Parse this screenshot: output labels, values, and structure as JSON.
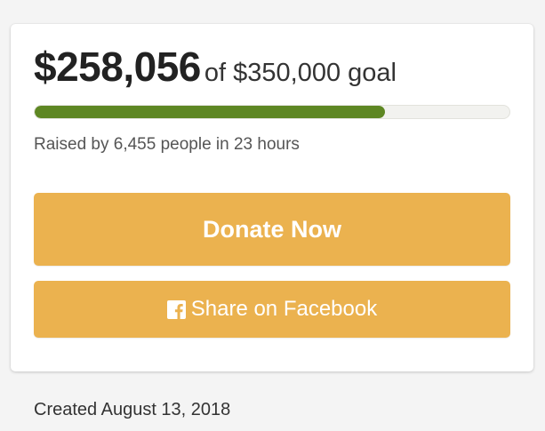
{
  "campaign": {
    "raised": "$258,056",
    "goal_text": "of $350,000 goal",
    "progress_fraction": 0.7373,
    "stats_text": "Raised by 6,455 people in 23 hours",
    "donate_label": "Donate Now",
    "share_label": "Share on Facebook",
    "share_icon": "facebook-icon",
    "created_text": "Created August 13, 2018"
  },
  "colors": {
    "progress_fill": "#5e8723",
    "button": "#ebb24f",
    "card_background": "#ffffff",
    "page_background": "#f4f4f4"
  }
}
